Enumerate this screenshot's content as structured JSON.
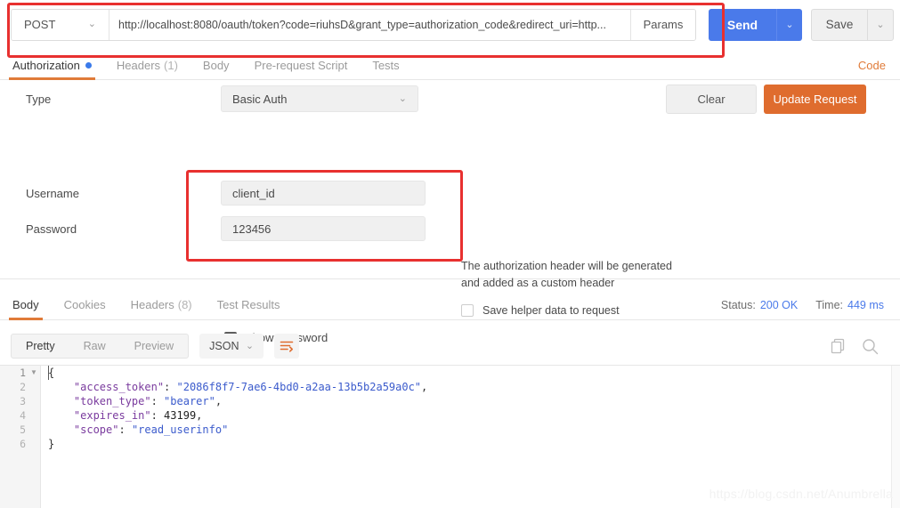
{
  "request_bar": {
    "method": "POST",
    "url": "http://localhost:8080/oauth/token?code=riuhsD&grant_type=authorization_code&redirect_uri=http...",
    "params_label": "Params",
    "send_label": "Send",
    "save_label": "Save",
    "send_color": "#4a7aea",
    "caret_glyph": "⌄"
  },
  "request_tabs": {
    "items": [
      {
        "label": "Authorization",
        "active": true,
        "badge": "",
        "dot": true
      },
      {
        "label": "Headers",
        "active": false,
        "badge": "(1)",
        "dot": false
      },
      {
        "label": "Body",
        "active": false,
        "badge": "",
        "dot": false
      },
      {
        "label": "Pre-request Script",
        "active": false,
        "badge": "",
        "dot": false
      },
      {
        "label": "Tests",
        "active": false,
        "badge": "",
        "dot": false
      }
    ],
    "code_link": "Code",
    "active_underline_color": "#e07b39",
    "dot_color": "#3a7aea"
  },
  "auth": {
    "type_label": "Type",
    "type_value": "Basic Auth",
    "clear_label": "Clear",
    "update_label": "Update Request",
    "update_color": "#df6c2e",
    "username_label": "Username",
    "username_value": "client_id",
    "password_label": "Password",
    "password_value": "123456",
    "show_password_label": "Show Password",
    "show_password_checked": true,
    "check_glyph": "✔",
    "helper_text": "The authorization header will be generated and added as a custom header",
    "save_helper_label": "Save helper data to request",
    "save_helper_checked": false
  },
  "response_tabs": {
    "items": [
      {
        "label": "Body",
        "active": true,
        "badge": ""
      },
      {
        "label": "Cookies",
        "active": false,
        "badge": ""
      },
      {
        "label": "Headers",
        "active": false,
        "badge": "(8)"
      },
      {
        "label": "Test Results",
        "active": false,
        "badge": ""
      }
    ],
    "status_label": "Status:",
    "status_value": "200 OK",
    "time_label": "Time:",
    "time_value": "449 ms",
    "value_color": "#4a7aea"
  },
  "response_toolbar": {
    "view_modes": [
      {
        "label": "Pretty",
        "active": true
      },
      {
        "label": "Raw",
        "active": false
      },
      {
        "label": "Preview",
        "active": false
      }
    ],
    "format": "JSON",
    "wrap_icon": "wrap-lines-icon",
    "copy_icon": "copy-icon",
    "search_icon": "search-icon"
  },
  "response_body": {
    "line_numbers": [
      "1",
      "2",
      "3",
      "4",
      "5",
      "6"
    ],
    "json": {
      "access_token": "2086f8f7-7ae6-4bd0-a2aa-13b5b2a59a0c",
      "token_type": "bearer",
      "expires_in": 43199,
      "scope": "read_userinfo"
    }
  },
  "annotations": {
    "boxes": [
      {
        "name": "url-bar-highlight",
        "color": "#e8302f"
      },
      {
        "name": "credentials-highlight",
        "color": "#e8302f"
      }
    ]
  },
  "watermark": "https://blog.csdn.net/Anumbrella"
}
